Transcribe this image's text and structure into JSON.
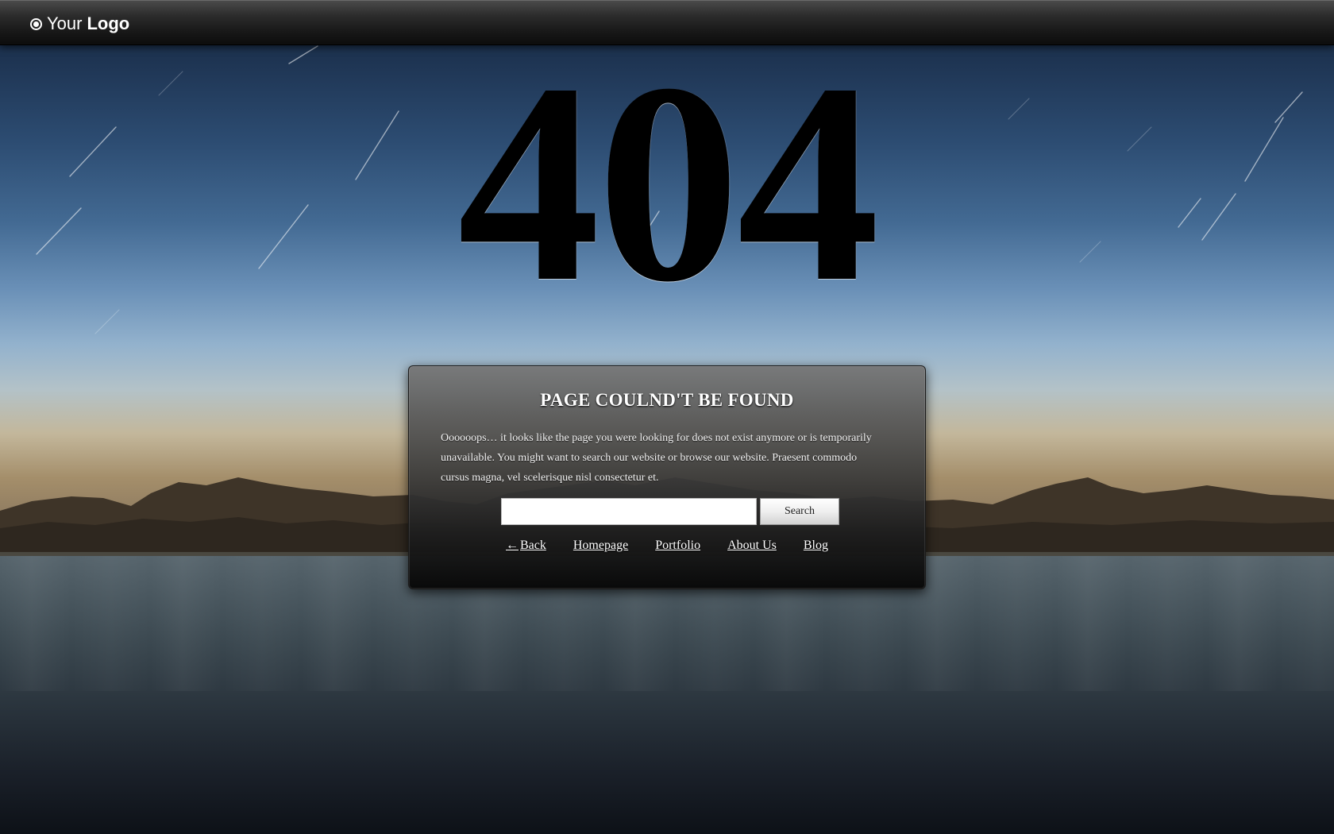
{
  "header": {
    "logo_regular": "Your",
    "logo_bold": "Logo",
    "logo_icon": "radio-dot-icon"
  },
  "error": {
    "code": "404",
    "title": "PAGE COULND'T BE FOUND",
    "message": "Oooooops… it looks like the page you were looking for does not exist anymore or is temporarily unavailable. You might want to search our website or browse our website. Praesent commodo cursus magna, vel scelerisque nisl consectetur et."
  },
  "search": {
    "value": "",
    "placeholder": "",
    "button_label": "Search"
  },
  "nav": {
    "back_arrow": "←",
    "back_label": "Back",
    "homepage_label": "Homepage",
    "portfolio_label": "Portfolio",
    "about_label": "About Us",
    "blog_label": "Blog"
  },
  "colors": {
    "topbar": "#1a1a1a",
    "sky_top": "#14243a",
    "horizon": "#c3b79b",
    "water": "#3c4951",
    "panel": "#3a3a3a",
    "text": "#ffffff"
  }
}
